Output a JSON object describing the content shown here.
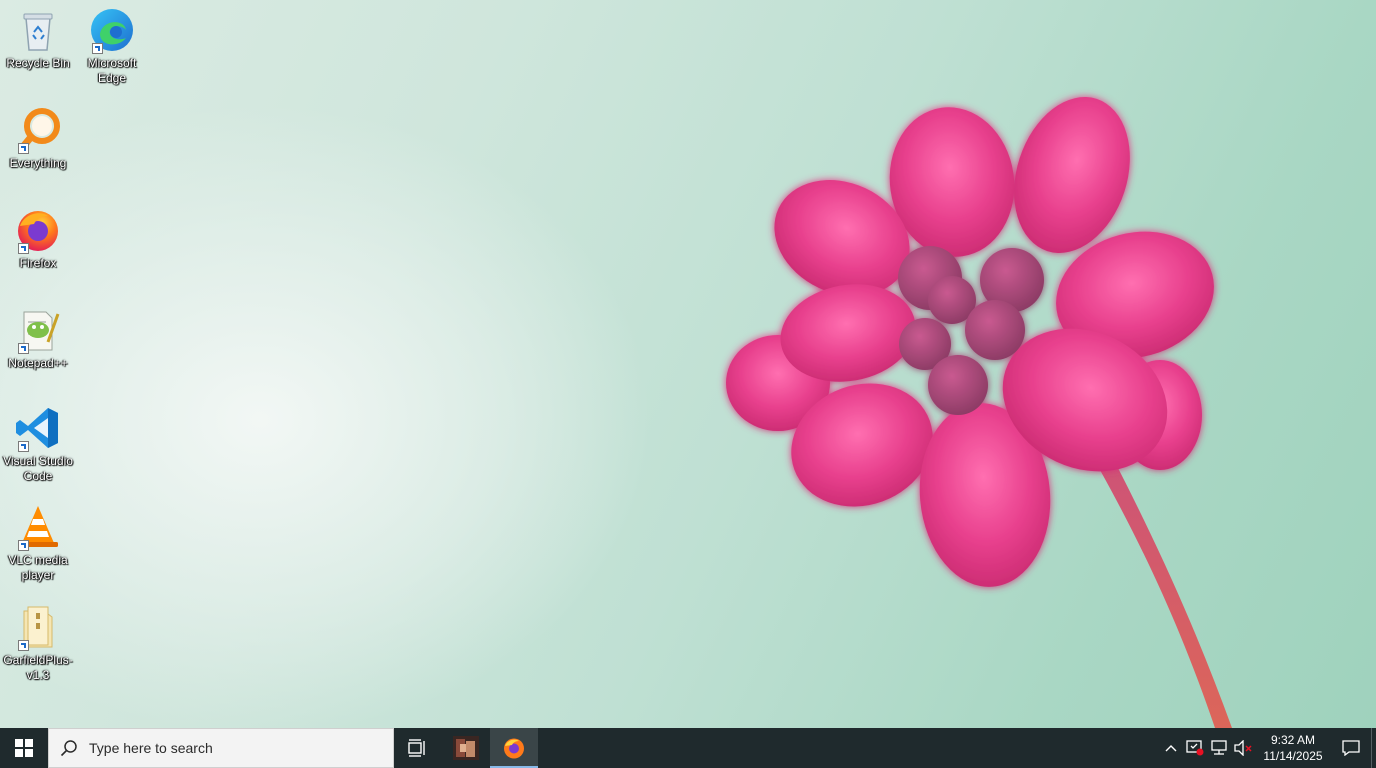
{
  "desktop": {
    "icons": [
      {
        "label": "Recycle Bin",
        "icon": "recycle-bin-icon"
      },
      {
        "label": "Microsoft Edge",
        "icon": "edge-icon"
      },
      {
        "label": "Everything",
        "icon": "everything-search-icon"
      },
      {
        "label": "Firefox",
        "icon": "firefox-icon"
      },
      {
        "label": "Notepad++",
        "icon": "notepad-plus-plus-icon"
      },
      {
        "label": "Visual Studio Code",
        "icon": "vscode-icon"
      },
      {
        "label": "VLC media player",
        "icon": "vlc-icon"
      },
      {
        "label": "GarfieldPlus-v1.3",
        "icon": "folder-zip-icon"
      }
    ]
  },
  "taskbar": {
    "start_icon": "windows-logo-icon",
    "search": {
      "placeholder": "Type here to search",
      "icon": "search-icon"
    },
    "apps": [
      {
        "name": "Task View",
        "icon": "task-view-icon",
        "active": false
      },
      {
        "name": "Image app",
        "icon": "image-thumbnail-icon",
        "active": false
      },
      {
        "name": "Firefox",
        "icon": "firefox-icon",
        "active": true
      }
    ],
    "tray": {
      "icons": [
        "chevron-up-icon",
        "security-alert-icon",
        "network-icon",
        "volume-muted-icon"
      ],
      "time": "9:32 AM",
      "date": "11/14/2025",
      "notification_icon": "notification-icon"
    }
  },
  "colors": {
    "taskbar_bg": "#1f2a2d",
    "flower_pink": "#e83f8e",
    "wallpaper_mint": "#a9d7c4",
    "active_indicator": "#87b9e8"
  }
}
